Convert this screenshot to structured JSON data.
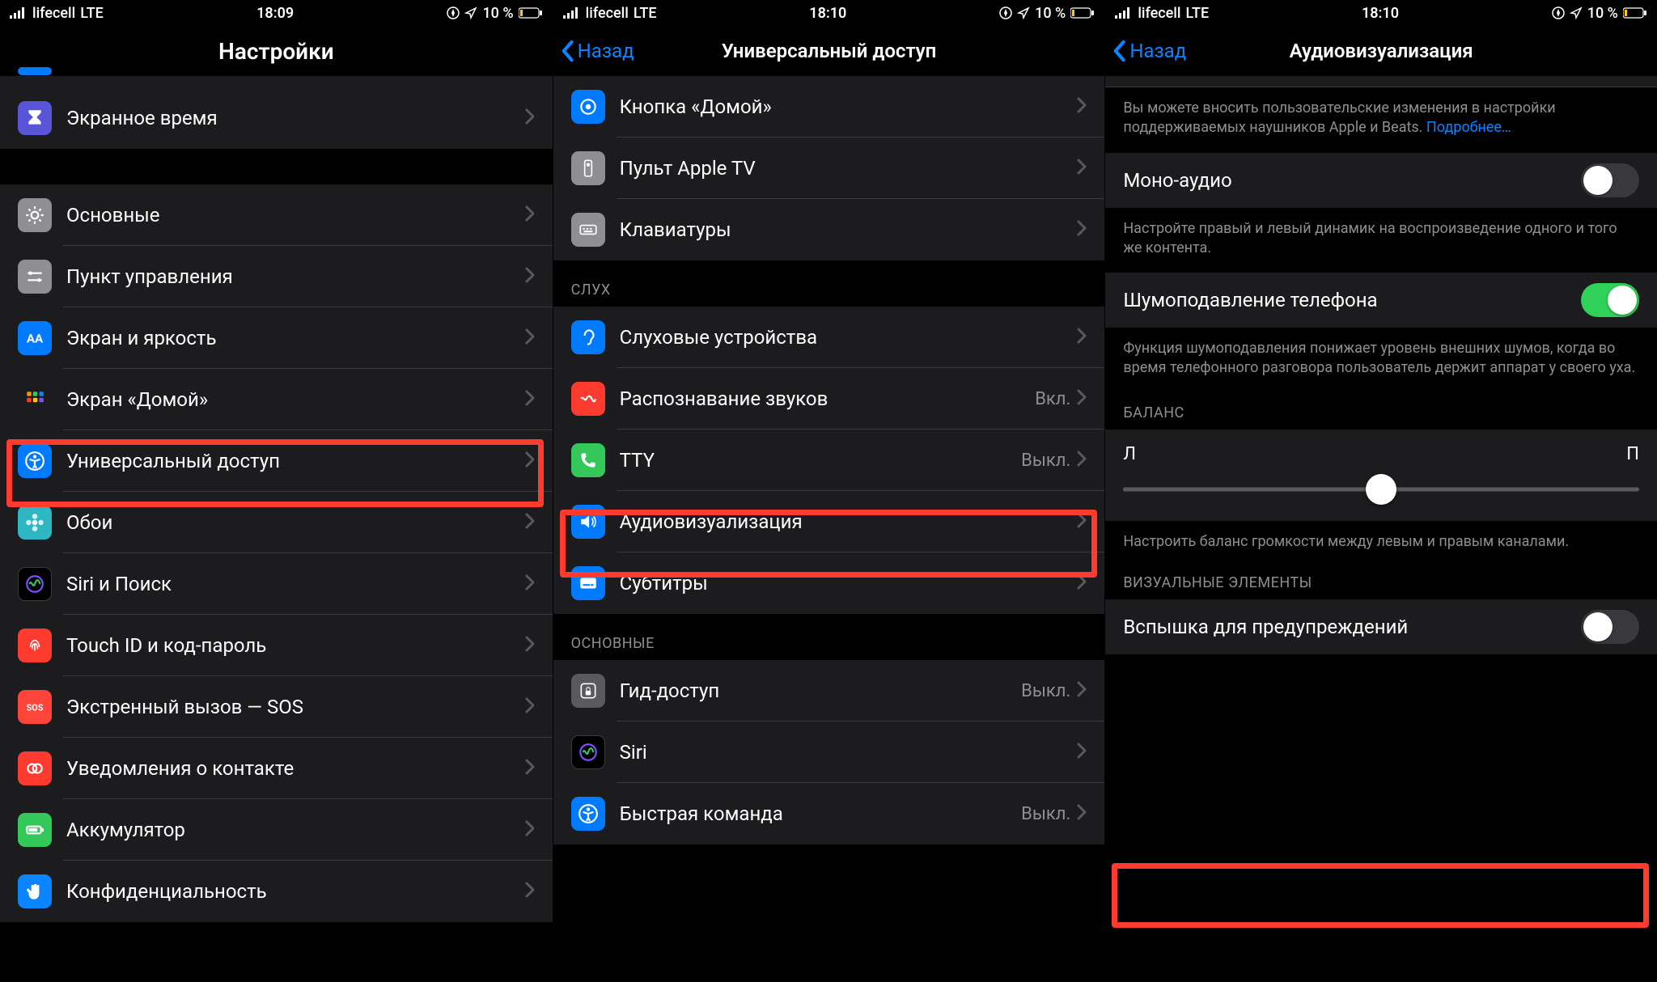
{
  "status": {
    "carrier": "lifecell",
    "network": "LTE",
    "battery_text": "10 %"
  },
  "panel1": {
    "time": "18:09",
    "title": "Настройки",
    "rows": [
      {
        "id": "screentime",
        "label": "Экранное время",
        "icon": "hourglass",
        "bg": "ic-purple"
      },
      {
        "id": "general",
        "label": "Основные",
        "icon": "gear",
        "bg": "ic-gray"
      },
      {
        "id": "control",
        "label": "Пункт управления",
        "icon": "sliders",
        "bg": "ic-gray"
      },
      {
        "id": "display",
        "label": "Экран и яркость",
        "icon": "aa",
        "bg": "ic-blue"
      },
      {
        "id": "home",
        "label": "Экран «Домой»",
        "icon": "grid",
        "bg": "ic-multi"
      },
      {
        "id": "accessibility",
        "label": "Универсальный доступ",
        "icon": "accessibility",
        "bg": "ic-blue"
      },
      {
        "id": "wallpaper",
        "label": "Обои",
        "icon": "flower",
        "bg": "ic-teal"
      },
      {
        "id": "siri",
        "label": "Siri и Поиск",
        "icon": "siri",
        "bg": "ic-black"
      },
      {
        "id": "touchid",
        "label": "Touch ID и код-пароль",
        "icon": "fingerprint",
        "bg": "ic-red"
      },
      {
        "id": "sos",
        "label": "Экстренный вызов — SOS",
        "icon": "sos",
        "bg": "ic-orange"
      },
      {
        "id": "exposure",
        "label": "Уведомления о контакте",
        "icon": "exposure",
        "bg": "ic-red"
      },
      {
        "id": "battery",
        "label": "Аккумулятор",
        "icon": "battery",
        "bg": "ic-green"
      },
      {
        "id": "privacy",
        "label": "Конфиденциальность",
        "icon": "hand",
        "bg": "ic-handblue"
      }
    ]
  },
  "panel2": {
    "time": "18:10",
    "back": "Назад",
    "title": "Универсальный доступ",
    "group_a": [
      {
        "id": "homebtn",
        "label": "Кнопка «Домой»",
        "icon": "circle",
        "bg": "ic-blue"
      },
      {
        "id": "appletv",
        "label": "Пульт Apple TV",
        "icon": "remote",
        "bg": "ic-gray"
      },
      {
        "id": "keyboards",
        "label": "Клавиатуры",
        "icon": "keyboard",
        "bg": "ic-gray"
      }
    ],
    "header_hearing": "СЛУХ",
    "group_b": [
      {
        "id": "hearing",
        "label": "Слуховые устройства",
        "icon": "ear",
        "bg": "ic-blue",
        "value": ""
      },
      {
        "id": "sounds",
        "label": "Распознавание звуков",
        "icon": "wave",
        "bg": "ic-red",
        "value": "Вкл."
      },
      {
        "id": "tty",
        "label": "TTY",
        "icon": "phone",
        "bg": "ic-green",
        "value": "Выкл."
      },
      {
        "id": "audiovis",
        "label": "Аудиовизуализация",
        "icon": "speaker",
        "bg": "ic-blue",
        "value": ""
      },
      {
        "id": "subtitles",
        "label": "Субтитры",
        "icon": "caption",
        "bg": "ic-blue",
        "value": ""
      }
    ],
    "header_general": "ОСНОВНЫЕ",
    "group_c": [
      {
        "id": "guided",
        "label": "Гид-доступ",
        "icon": "lock",
        "bg": "ic-darkgray",
        "value": "Выкл."
      },
      {
        "id": "siri2",
        "label": "Siri",
        "icon": "siri",
        "bg": "ic-black",
        "value": ""
      },
      {
        "id": "shortcut",
        "label": "Быстрая команда",
        "icon": "accessibility",
        "bg": "ic-blue",
        "value": "Выкл."
      }
    ]
  },
  "panel3": {
    "time": "18:10",
    "back": "Назад",
    "title": "Аудиовизуализация",
    "desc1_a": "Вы можете вносить пользовательские изменения в настройки поддерживаемых наушников Apple и Beats. ",
    "desc1_link": "Подробнее…",
    "mono_label": "Моно-аудио",
    "desc2": "Настройте правый и левый динамик на воспроизведение одного и того же контента.",
    "noise_label": "Шумоподавление телефона",
    "desc3": "Функция шумоподавления понижает уровень внешних шумов, когда во время телефонного разговора пользователь держит аппарат у своего уха.",
    "balance_header": "БАЛАНС",
    "balance_left": "Л",
    "balance_right": "П",
    "desc4": "Настроить баланс громкости между левым и правым каналами.",
    "visual_header": "ВИЗУАЛЬНЫЕ ЭЛЕМЕНТЫ",
    "flash_label": "Вспышка для предупреждений"
  }
}
